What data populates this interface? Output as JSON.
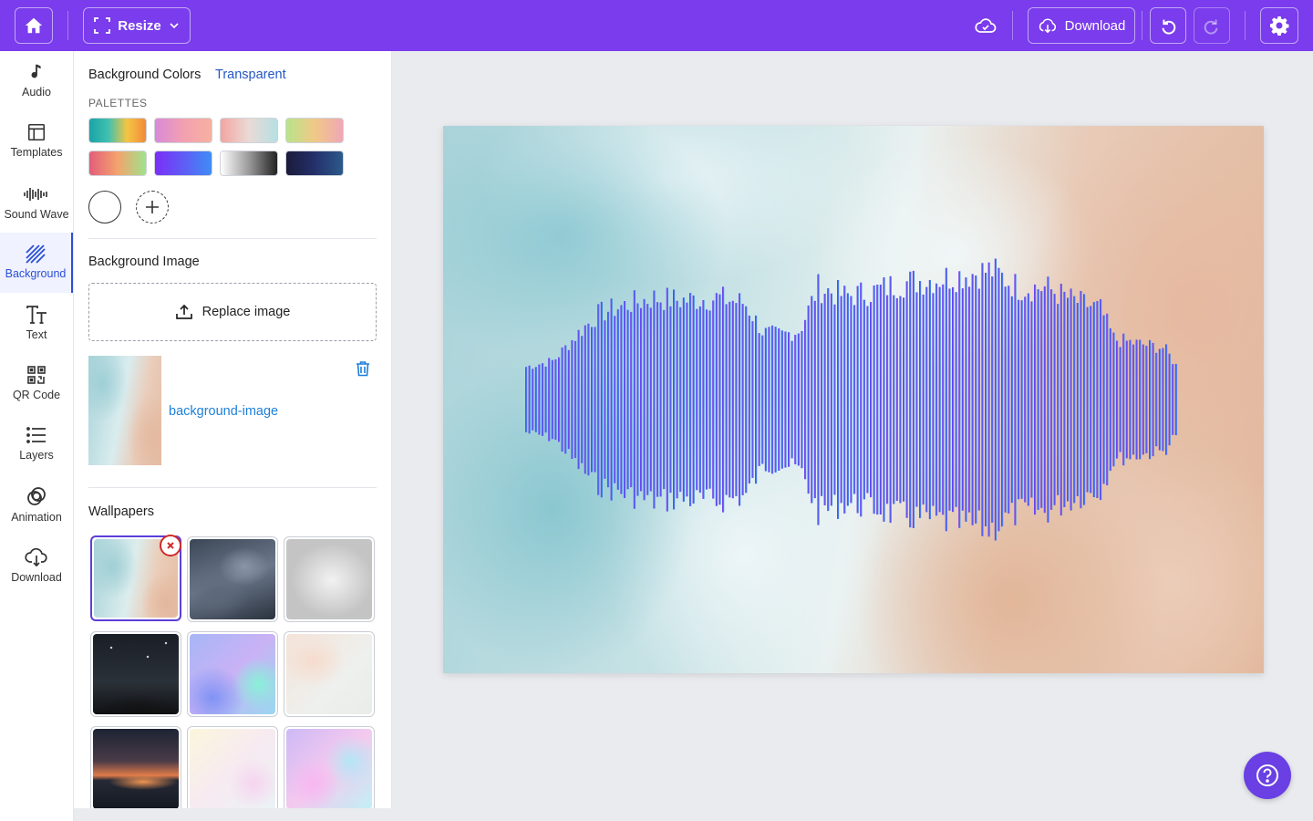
{
  "topbar": {
    "resize_label": "Resize",
    "download_label": "Download",
    "accent": "#7a3cec"
  },
  "rail": {
    "items": [
      {
        "label": "Audio",
        "icon": "music-note-icon"
      },
      {
        "label": "Templates",
        "icon": "templates-icon"
      },
      {
        "label": "Sound Wave",
        "icon": "sound-wave-icon"
      },
      {
        "label": "Background",
        "icon": "background-icon",
        "active": true
      },
      {
        "label": "Text",
        "icon": "text-icon"
      },
      {
        "label": "QR Code",
        "icon": "qr-code-icon"
      },
      {
        "label": "Layers",
        "icon": "layers-icon"
      },
      {
        "label": "Animation",
        "icon": "animation-icon"
      },
      {
        "label": "Download",
        "icon": "download-icon"
      }
    ]
  },
  "panel": {
    "bg_colors_title": "Background Colors",
    "transparent_link": "Transparent",
    "palettes_label": "PALETTES",
    "palettes": [
      "linear-gradient(90deg,#1aa3a8,#3fc1b0,#f5c542,#f28a3b)",
      "linear-gradient(90deg,#d88ad8,#f2a0b0,#f7b1a0)",
      "linear-gradient(90deg,#f3a5a0,#eadad6,#b6e0e3)",
      "linear-gradient(90deg,#b9e38a,#f0c987,#f0a7b6)",
      "linear-gradient(90deg,#e35d7a,#f4a36e,#9ee38b)",
      "linear-gradient(90deg,#7b2ff7,#5f5cf5,#3f8df5)",
      "linear-gradient(90deg,#ffffff,#9a9a9a,#222222)",
      "linear-gradient(90deg,#1b1b3a,#24306b,#2c5a8a)"
    ],
    "bg_image_title": "Background Image",
    "replace_label": "Replace image",
    "image_name": "background-image",
    "wallpapers_title": "Wallpapers"
  }
}
